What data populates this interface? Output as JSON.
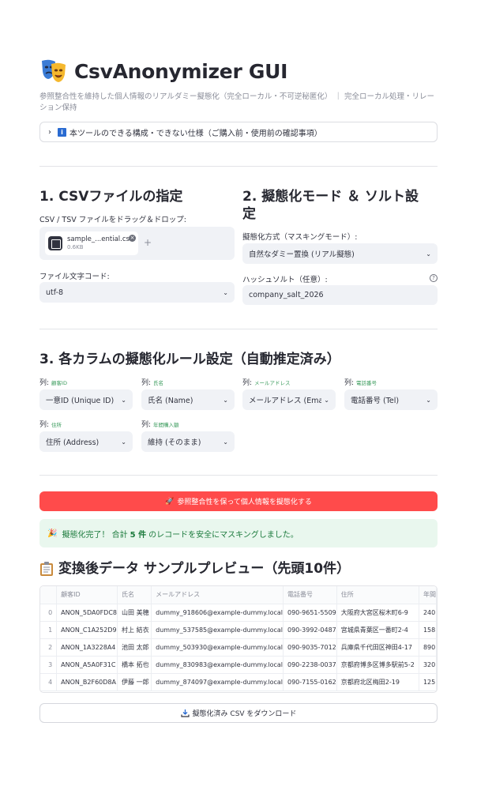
{
  "app": {
    "title": "CsvAnonymizer GUI",
    "caption": "参照整合性を維持した個人情報のリアルダミー擬態化（完全ローカル・不可逆秘匿化） ｜ 完全ローカル処理・リレーション保持",
    "expander_label": "本ツールのできる構成・できない仕様（ご購入前・使用前の確認事項）"
  },
  "section1": {
    "heading": "1. CSVファイルの指定",
    "uploader_label": "CSV / TSV ファイルをドラッグ＆ドロップ:",
    "file_name": "sample_...ential.csv",
    "file_size": "0.6KB",
    "encoding_label": "ファイル文字コード:",
    "encoding_value": "utf-8"
  },
  "section2": {
    "heading": "2. 擬態化モード ＆ ソルト設定",
    "mode_label": "擬態化方式（マスキングモード）:",
    "mode_value": "自然なダミー置換 (リアル擬態)",
    "salt_label": "ハッシュソルト（任意）:",
    "salt_value": "company_salt_2026"
  },
  "section3": {
    "heading": "3. 各カラムの擬態化ルール設定（自動推定済み）",
    "columns": [
      {
        "prefix": "列:",
        "name": "顧客ID",
        "rule": "一意ID (Unique ID)"
      },
      {
        "prefix": "列:",
        "name": "氏名",
        "rule": "氏名 (Name)"
      },
      {
        "prefix": "列:",
        "name": "メールアドレス",
        "rule": "メールアドレス (Email"
      },
      {
        "prefix": "列:",
        "name": "電話番号",
        "rule": "電話番号 (Tel)"
      },
      {
        "prefix": "列:",
        "name": "住所",
        "rule": "住所 (Address)"
      },
      {
        "prefix": "列:",
        "name": "年間購入額",
        "rule": "維持 (そのまま)"
      }
    ]
  },
  "actions": {
    "anonymize_button": "参照整合性を保って個人情報を擬態化する",
    "success_prefix": "擬態化完了！ 合計",
    "success_count": "5 件",
    "success_suffix": "のレコードを安全にマスキングしました。",
    "download_button": "擬態化済み CSV をダウンロード"
  },
  "preview": {
    "heading": "変換後データ サンプルプレビュー（先頭10件）",
    "headers": [
      "",
      "顧客ID",
      "氏名",
      "メールアドレス",
      "電話番号",
      "住所",
      "年間"
    ],
    "rows": [
      [
        "0",
        "ANON_5DA0FDC8",
        "山田 美穂",
        "dummy_918606@example-dummy.local",
        "090-9651-5509",
        "大阪府大宮区桜木町6-9",
        "240"
      ],
      [
        "1",
        "ANON_C1A252D9",
        "村上 結衣",
        "dummy_537585@example-dummy.local",
        "090-3992-0487",
        "宮城県青葉区一番町2-4",
        "158"
      ],
      [
        "2",
        "ANON_1A3228A4",
        "池田 太郎",
        "dummy_503930@example-dummy.local",
        "090-9035-7012",
        "兵庫県千代田区神田4-17",
        "890"
      ],
      [
        "3",
        "ANON_A5A0F31C",
        "橋本 拓也",
        "dummy_830983@example-dummy.local",
        "090-2238-0037",
        "京都府博多区博多駅前5-2",
        "320"
      ],
      [
        "4",
        "ANON_B2F60D8A",
        "伊藤 一郎",
        "dummy_874097@example-dummy.local",
        "090-7155-0162",
        "京都府北区梅田2-19",
        "125"
      ]
    ]
  },
  "colors": {
    "primary": "#ff4b4b",
    "success_bg": "#e9f7ee",
    "success_text": "#1b7a3c",
    "input_bg": "#f0f2f6",
    "info_blue": "#2a6bd1"
  },
  "icons": {
    "title": "theater-masks-icon",
    "rocket": "rocket-icon",
    "party": "party-popper-icon",
    "clipboard": "clipboard-icon",
    "download": "download-icon"
  }
}
